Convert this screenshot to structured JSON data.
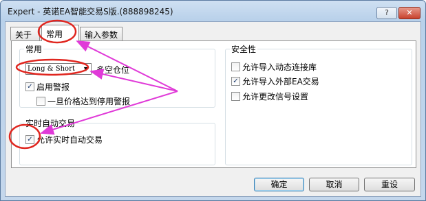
{
  "window": {
    "title": "Expert - 英诺EA智能交易S版.(888898245)",
    "help_label": "?",
    "close_label": "✕"
  },
  "tabs": [
    {
      "label": "关于"
    },
    {
      "label": "常用"
    },
    {
      "label": "输入参数"
    }
  ],
  "common_group": {
    "title": "常用",
    "position_select": {
      "value": "Long & Short"
    },
    "position_label": "多空仓位",
    "enable_alerts": {
      "label": "启用警报",
      "checked": true
    },
    "disable_alert_on_price": {
      "label": "一旦价格达到停用警报",
      "checked": false
    }
  },
  "live_trading_group": {
    "title": "实时自动交易",
    "allow_live_trading": {
      "label": "允许实时自动交易",
      "checked": true
    }
  },
  "safety_group": {
    "title": "安全性",
    "allow_dll_imports": {
      "label": "允许导入动态连接库",
      "checked": false
    },
    "allow_external_experts": {
      "label": "允许导入外部EA交易",
      "checked": true
    },
    "allow_signal_changes": {
      "label": "允许更改信号设置",
      "checked": false
    }
  },
  "buttons": {
    "ok": "确定",
    "cancel": "取消",
    "reset": "重设"
  },
  "colors": {
    "annotation_red": "#e0261f",
    "annotation_magenta": "#e03ad8",
    "window_frame": "#b9d1ea"
  }
}
